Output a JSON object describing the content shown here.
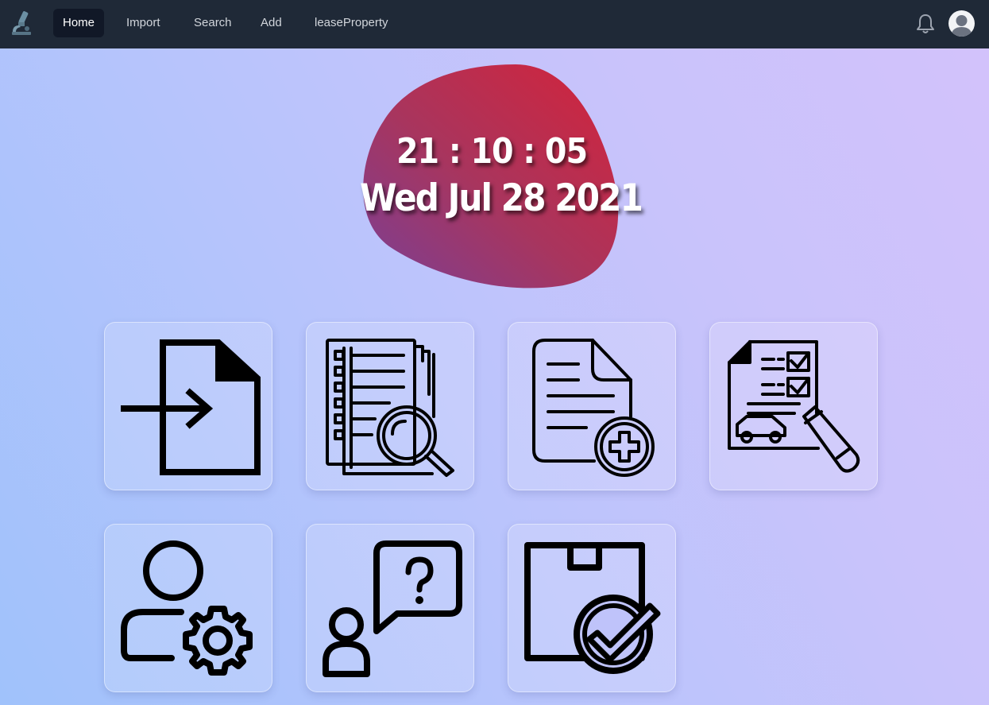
{
  "nav": {
    "logo_icon": "microscope-icon",
    "items": [
      {
        "label": "Home",
        "active": true
      },
      {
        "label": "Import",
        "active": false
      },
      {
        "label": "Search",
        "active": false
      },
      {
        "label": "Add",
        "active": false
      },
      {
        "label": "leaseProperty",
        "active": false
      }
    ],
    "notification_icon": "bell-icon",
    "avatar_icon": "user-avatar-icon"
  },
  "clock": {
    "time": "21 : 10 : 05",
    "date": "Wed Jul 28 2021",
    "blob_colors": [
      "#c8283f",
      "#8c3c88"
    ]
  },
  "tiles": [
    {
      "icon": "file-import-icon"
    },
    {
      "icon": "document-search-icon"
    },
    {
      "icon": "add-document-icon"
    },
    {
      "icon": "car-lease-contract-icon"
    },
    {
      "icon": "user-settings-icon"
    },
    {
      "icon": "user-question-icon"
    },
    {
      "icon": "package-check-icon"
    }
  ],
  "colors": {
    "navbar": "#1f2937",
    "nav_active": "#111827",
    "icon_stroke": "#000000"
  }
}
